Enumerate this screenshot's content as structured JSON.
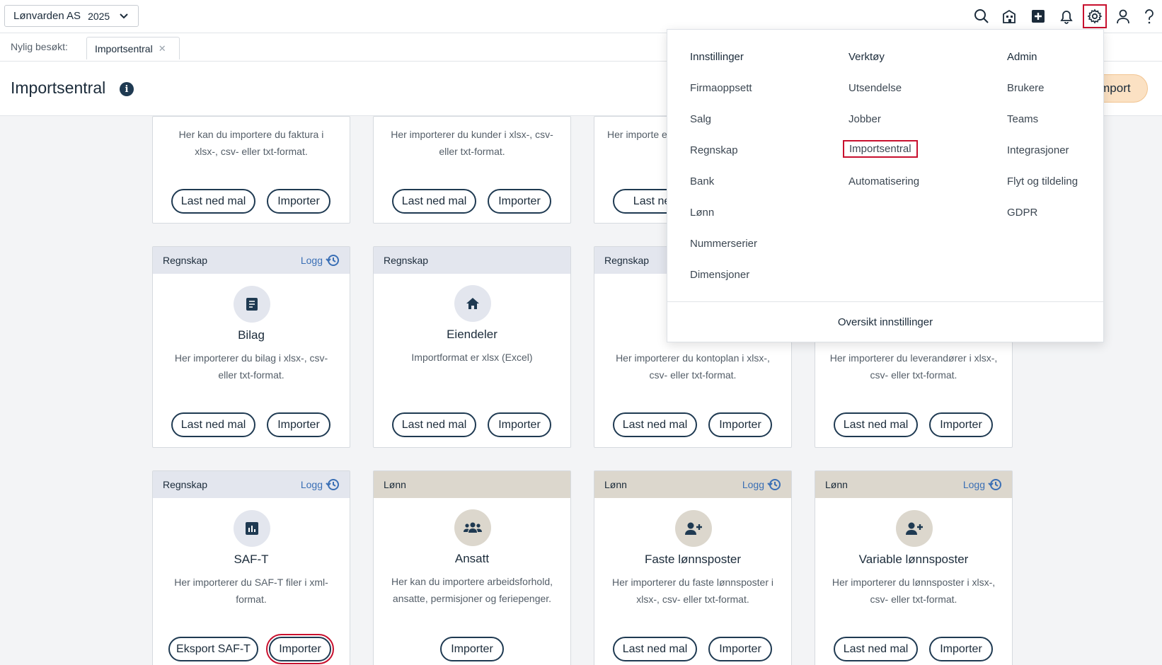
{
  "topbar": {
    "company": "Lønvarden AS",
    "year": "2025",
    "icons": [
      "search-icon",
      "building-icon",
      "add-icon",
      "bell-icon",
      "gear-icon",
      "user-icon",
      "help-icon"
    ]
  },
  "recent": {
    "label": "Nylig besøkt:",
    "tabs": [
      {
        "label": "Importsentral"
      }
    ]
  },
  "page": {
    "title": "Importsentral",
    "import_button": "Import"
  },
  "cards": [
    {
      "desc": "Her kan du importere du faktura i xlsx-, csv- eller txt-format.",
      "buttons": [
        "Last ned mal",
        "Importer"
      ]
    },
    {
      "desc": "Her importerer du kunder i xlsx-, csv- eller txt-format.",
      "buttons": [
        "Last ned mal",
        "Importer"
      ]
    },
    {
      "desc": "Her importe el",
      "buttons": [
        "Last ned"
      ]
    },
    {
      "category": "Regnskap",
      "logg": "Logg",
      "title": "Bilag",
      "desc": "Her importerer du bilag i xlsx-, csv- eller txt-format.",
      "buttons": [
        "Last ned mal",
        "Importer"
      ]
    },
    {
      "category": "Regnskap",
      "title": "Eiendeler",
      "desc": "Importformat er xlsx (Excel)",
      "buttons": [
        "Last ned mal",
        "Importer"
      ]
    },
    {
      "category": "Regnskap",
      "desc": "Her importerer du kontoplan i xlsx-, csv- eller txt-format.",
      "buttons": [
        "Last ned mal",
        "Importer"
      ]
    },
    {
      "desc": "Her importerer du leverandører i xlsx-, csv- eller txt-format.",
      "buttons": [
        "Last ned mal",
        "Importer"
      ]
    },
    {
      "category": "Regnskap",
      "logg": "Logg",
      "title": "SAF-T",
      "desc": "Her importerer du SAF-T filer i xml-format.",
      "buttons": [
        "Eksport SAF-T",
        "Importer"
      ]
    },
    {
      "category": "Lønn",
      "title": "Ansatt",
      "desc": "Her kan du importere arbeidsforhold, ansatte, permisjoner og feriepenger.",
      "buttons": [
        "Importer"
      ]
    },
    {
      "category": "Lønn",
      "logg": "Logg",
      "title": "Faste lønnsposter",
      "desc": "Her importerer du faste lønnsposter i xlsx-, csv- eller txt-format.",
      "buttons": [
        "Last ned mal",
        "Importer"
      ]
    },
    {
      "category": "Lønn",
      "logg": "Logg",
      "title": "Variable lønnsposter",
      "desc": "Her importerer du lønnsposter i xlsx-, csv- eller txt-format.",
      "buttons": [
        "Last ned mal",
        "Importer"
      ]
    }
  ],
  "menu": {
    "columns": [
      {
        "title": "Innstillinger",
        "items": [
          "Firmaoppsett",
          "Salg",
          "Regnskap",
          "Bank",
          "Lønn",
          "Nummerserier",
          "Dimensjoner"
        ]
      },
      {
        "title": "Verktøy",
        "items": [
          "Utsendelse",
          "Jobber",
          "Importsentral",
          "Automatisering"
        ]
      },
      {
        "title": "Admin",
        "items": [
          "Brukere",
          "Teams",
          "Integrasjoner",
          "Flyt og tildeling",
          "GDPR"
        ]
      }
    ],
    "active_item": "Importsentral",
    "footer": "Oversikt innstillinger"
  },
  "colors": {
    "accent": "#1f3a52",
    "highlight": "#c8102e",
    "regnskap_header": "#e3e6ee",
    "lonn_header": "#dcd7cd",
    "import_button": "#fbe1c3"
  }
}
